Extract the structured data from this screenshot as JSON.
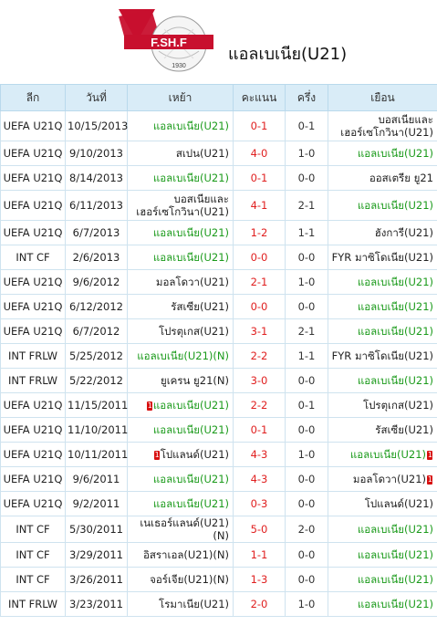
{
  "header": {
    "logo_text": "F.SH.F",
    "logo_year": "1930",
    "team_title": "แอลเบเนีย(U21)"
  },
  "columns": [
    "ลีก",
    "วันที่",
    "เหย้า",
    "คะแนน",
    "ครึ่ง",
    "เยือน"
  ],
  "colors": {
    "header_bg": "#d9ecf7",
    "score": "#e02020",
    "highlight": "#1a9a1a",
    "card": "#d81010"
  },
  "rows": [
    {
      "league": "UEFA U21Q",
      "date": "10/15/2013",
      "home": "แอลเบเนีย(U21)",
      "score": "0-1",
      "half": "0-1",
      "away": "บอสเนียและเฮอร์เซโกวินา(U21)",
      "home_hl": true,
      "away_hl": false,
      "tall": true
    },
    {
      "league": "UEFA U21Q",
      "date": "9/10/2013",
      "home": "สเปน(U21)",
      "score": "4-0",
      "half": "1-0",
      "away": "แอลเบเนีย(U21)",
      "home_hl": false,
      "away_hl": true
    },
    {
      "league": "UEFA U21Q",
      "date": "8/14/2013",
      "home": "แอลเบเนีย(U21)",
      "score": "0-1",
      "half": "0-0",
      "away": "ออสเตรีย ยู21",
      "home_hl": true,
      "away_hl": false
    },
    {
      "league": "UEFA U21Q",
      "date": "6/11/2013",
      "home": "บอสเนียและเฮอร์เซโกวินา(U21)",
      "score": "4-1",
      "half": "2-1",
      "away": "แอลเบเนีย(U21)",
      "home_hl": false,
      "away_hl": true,
      "tall": true
    },
    {
      "league": "UEFA U21Q",
      "date": "6/7/2013",
      "home": "แอลเบเนีย(U21)",
      "score": "1-2",
      "half": "1-1",
      "away": "ฮังการี(U21)",
      "home_hl": true,
      "away_hl": false
    },
    {
      "league": "INT CF",
      "date": "2/6/2013",
      "home": "แอลเบเนีย(U21)",
      "score": "0-0",
      "half": "0-0",
      "away": "FYR มาซิโดเนีย(U21)",
      "home_hl": true,
      "away_hl": false
    },
    {
      "league": "UEFA U21Q",
      "date": "9/6/2012",
      "home": "มอลโดวา(U21)",
      "score": "2-1",
      "half": "1-0",
      "away": "แอลเบเนีย(U21)",
      "home_hl": false,
      "away_hl": true
    },
    {
      "league": "UEFA U21Q",
      "date": "6/12/2012",
      "home": "รัสเซีย(U21)",
      "score": "0-0",
      "half": "0-0",
      "away": "แอลเบเนีย(U21)",
      "home_hl": false,
      "away_hl": true
    },
    {
      "league": "UEFA U21Q",
      "date": "6/7/2012",
      "home": "โปรตุเกส(U21)",
      "score": "3-1",
      "half": "2-1",
      "away": "แอลเบเนีย(U21)",
      "home_hl": false,
      "away_hl": true
    },
    {
      "league": "INT FRLW",
      "date": "5/25/2012",
      "home": "แอลเบเนีย(U21)(N)",
      "score": "2-2",
      "half": "1-1",
      "away": "FYR มาซิโดเนีย(U21)",
      "home_hl": true,
      "away_hl": false
    },
    {
      "league": "INT FRLW",
      "date": "5/22/2012",
      "home": "ยูเครน ยู21(N)",
      "score": "3-0",
      "half": "0-0",
      "away": "แอลเบเนีย(U21)",
      "home_hl": false,
      "away_hl": true
    },
    {
      "league": "UEFA U21Q",
      "date": "11/15/2011",
      "home": "แอลเบเนีย(U21)",
      "score": "2-2",
      "half": "0-1",
      "away": "โปรตุเกส(U21)",
      "home_hl": true,
      "away_hl": false,
      "home_card": "1"
    },
    {
      "league": "UEFA U21Q",
      "date": "11/10/2011",
      "home": "แอลเบเนีย(U21)",
      "score": "0-1",
      "half": "0-0",
      "away": "รัสเซีย(U21)",
      "home_hl": true,
      "away_hl": false
    },
    {
      "league": "UEFA U21Q",
      "date": "10/11/2011",
      "home": "โปแลนด์(U21)",
      "score": "4-3",
      "half": "1-0",
      "away": "แอลเบเนีย(U21)",
      "home_hl": false,
      "away_hl": true,
      "home_card": "1",
      "away_card": "1"
    },
    {
      "league": "UEFA U21Q",
      "date": "9/6/2011",
      "home": "แอลเบเนีย(U21)",
      "score": "4-3",
      "half": "0-0",
      "away": "มอลโดวา(U21)",
      "home_hl": true,
      "away_hl": false,
      "away_card": "1"
    },
    {
      "league": "UEFA U21Q",
      "date": "9/2/2011",
      "home": "แอลเบเนีย(U21)",
      "score": "0-3",
      "half": "0-0",
      "away": "โปแลนด์(U21)",
      "home_hl": true,
      "away_hl": false
    },
    {
      "league": "INT CF",
      "date": "5/30/2011",
      "home": "เนเธอร์แลนด์(U21)(N)",
      "score": "5-0",
      "half": "2-0",
      "away": "แอลเบเนีย(U21)",
      "home_hl": false,
      "away_hl": true
    },
    {
      "league": "INT CF",
      "date": "3/29/2011",
      "home": "อิสราเอล(U21)(N)",
      "score": "1-1",
      "half": "0-0",
      "away": "แอลเบเนีย(U21)",
      "home_hl": false,
      "away_hl": true
    },
    {
      "league": "INT CF",
      "date": "3/26/2011",
      "home": "จอร์เจีย(U21)(N)",
      "score": "1-3",
      "half": "0-0",
      "away": "แอลเบเนีย(U21)",
      "home_hl": false,
      "away_hl": true
    },
    {
      "league": "INT FRLW",
      "date": "3/23/2011",
      "home": "โรมาเนีย(U21)",
      "score": "2-0",
      "half": "1-0",
      "away": "แอลเบเนีย(U21)",
      "home_hl": false,
      "away_hl": true
    }
  ]
}
